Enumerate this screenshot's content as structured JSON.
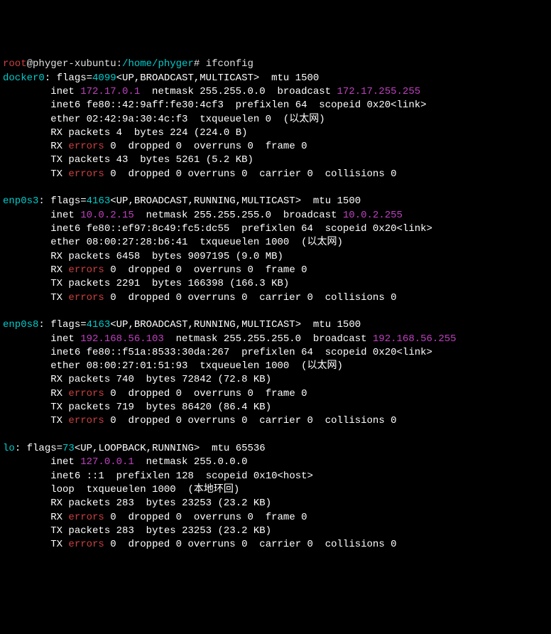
{
  "prompt": {
    "user": "root",
    "at": "@",
    "host": "phyger-xubuntu",
    "sep": ":",
    "path": "/home/phyger",
    "sym": "#",
    "cmd": "ifconfig"
  },
  "ifaces": [
    {
      "name": "docker0",
      "flags_num": "4099",
      "flags_list": "UP,BROADCAST,MULTICAST",
      "mtu": "1500",
      "inet": "172.17.0.1",
      "netmask": "255.255.0.0",
      "broadcast": "172.17.255.255",
      "inet6": "fe80::42:9aff:fe30:4cf3",
      "prefixlen": "64",
      "scopeid": "0x20",
      "scope_txt": "<link>",
      "ether": "02:42:9a:30:4c:f3",
      "txq": "0",
      "type": "(以太网)",
      "rx_packets": "4",
      "rx_bytes": "224",
      "rx_human": "(224.0 B)",
      "rx_err": "0",
      "rx_drop": "0",
      "rx_over": "0",
      "rx_frame": "0",
      "tx_packets": "43",
      "tx_bytes": "5261",
      "tx_human": "(5.2 KB)",
      "tx_err": "0",
      "tx_drop": "0",
      "tx_over": "0",
      "tx_carrier": "0",
      "tx_coll": "0"
    },
    {
      "name": "enp0s3",
      "flags_num": "4163",
      "flags_list": "UP,BROADCAST,RUNNING,MULTICAST",
      "mtu": "1500",
      "inet": "10.0.2.15",
      "netmask": "255.255.255.0",
      "broadcast": "10.0.2.255",
      "inet6": "fe80::ef97:8c49:fc5:dc55",
      "prefixlen": "64",
      "scopeid": "0x20",
      "scope_txt": "<link>",
      "ether": "08:00:27:28:b6:41",
      "txq": "1000",
      "type": "(以太网)",
      "rx_packets": "6458",
      "rx_bytes": "9097195",
      "rx_human": "(9.0 MB)",
      "rx_err": "0",
      "rx_drop": "0",
      "rx_over": "0",
      "rx_frame": "0",
      "tx_packets": "2291",
      "tx_bytes": "166398",
      "tx_human": "(166.3 KB)",
      "tx_err": "0",
      "tx_drop": "0",
      "tx_over": "0",
      "tx_carrier": "0",
      "tx_coll": "0"
    },
    {
      "name": "enp0s8",
      "flags_num": "4163",
      "flags_list": "UP,BROADCAST,RUNNING,MULTICAST",
      "mtu": "1500",
      "inet": "192.168.56.103",
      "netmask": "255.255.255.0",
      "broadcast": "192.168.56.255",
      "inet6": "fe80::f51a:8533:30da:267",
      "prefixlen": "64",
      "scopeid": "0x20",
      "scope_txt": "<link>",
      "ether": "08:00:27:01:51:93",
      "txq": "1000",
      "type": "(以太网)",
      "rx_packets": "740",
      "rx_bytes": "72842",
      "rx_human": "(72.8 KB)",
      "rx_err": "0",
      "rx_drop": "0",
      "rx_over": "0",
      "rx_frame": "0",
      "tx_packets": "719",
      "tx_bytes": "86420",
      "tx_human": "(86.4 KB)",
      "tx_err": "0",
      "tx_drop": "0",
      "tx_over": "0",
      "tx_carrier": "0",
      "tx_coll": "0"
    },
    {
      "name": "lo",
      "flags_num": "73",
      "flags_list": "UP,LOOPBACK,RUNNING",
      "mtu": "65536",
      "inet": "127.0.0.1",
      "netmask": "255.0.0.0",
      "broadcast": "",
      "inet6": "::1",
      "prefixlen": "128",
      "scopeid": "0x10",
      "scope_txt": "<host>",
      "ether": "",
      "txq": "1000",
      "type": "(本地环回)",
      "loop": "loop",
      "rx_packets": "283",
      "rx_bytes": "23253",
      "rx_human": "(23.2 KB)",
      "rx_err": "0",
      "rx_drop": "0",
      "rx_over": "0",
      "rx_frame": "0",
      "tx_packets": "283",
      "tx_bytes": "23253",
      "tx_human": "(23.2 KB)",
      "tx_err": "0",
      "tx_drop": "0",
      "tx_over": "0",
      "tx_carrier": "0",
      "tx_coll": "0"
    }
  ]
}
